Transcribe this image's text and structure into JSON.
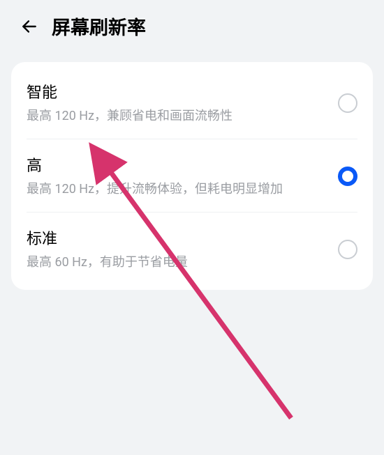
{
  "header": {
    "title": "屏幕刷新率"
  },
  "options": {
    "smart": {
      "title": "智能",
      "desc": "最高 120 Hz，兼顾省电和画面流畅性",
      "selected": false
    },
    "high": {
      "title": "高",
      "desc": "最高 120 Hz，提升流畅体验，但耗电明显增加",
      "selected": true
    },
    "standard": {
      "title": "标准",
      "desc": "最高 60 Hz，有助于节省电量",
      "selected": false
    }
  }
}
